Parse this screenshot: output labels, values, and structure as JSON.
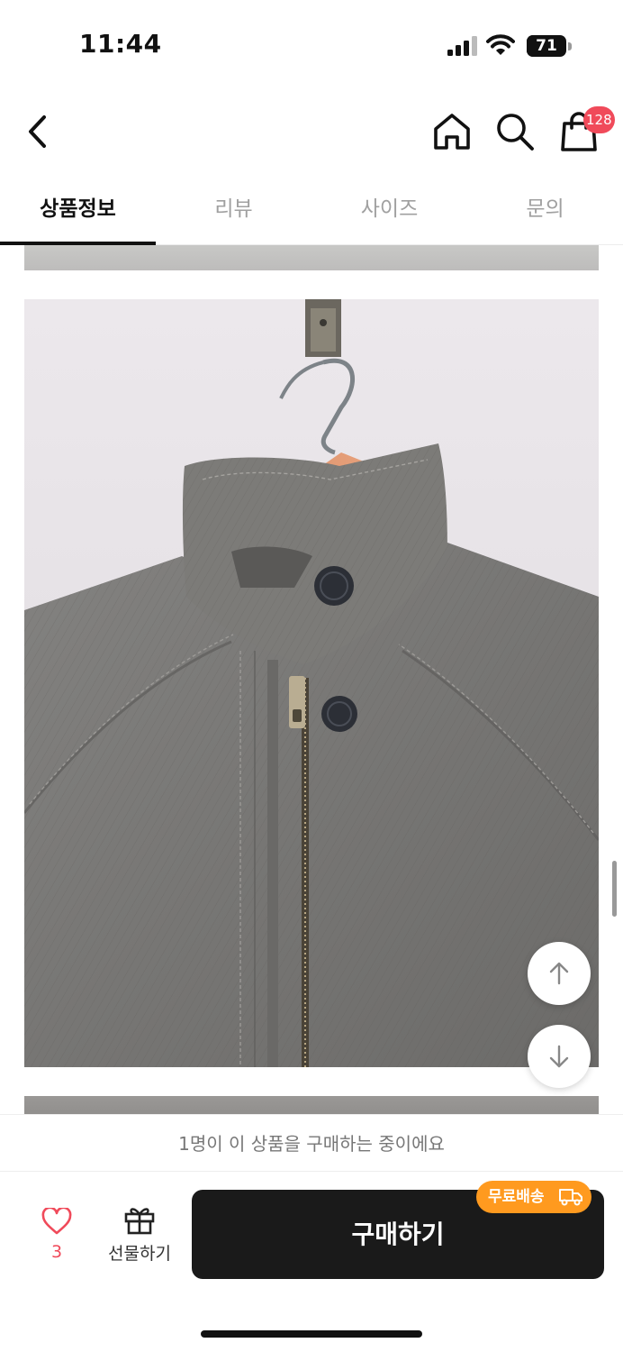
{
  "status_bar": {
    "time": "11:44",
    "battery": "71",
    "battery_level": 0.71
  },
  "header": {
    "back_icon": "chevron-left-icon",
    "home_icon": "home-icon",
    "search_icon": "search-icon",
    "cart_icon": "shopping-bag-icon",
    "cart_badge": "128",
    "badge_color": "#f04a5a"
  },
  "tabs": [
    {
      "label": "상품정보",
      "active": true
    },
    {
      "label": "리뷰",
      "active": false
    },
    {
      "label": "사이즈",
      "active": false
    },
    {
      "label": "문의",
      "active": false
    }
  ],
  "content": {
    "photo_subject": "gray denim zip jacket on wooden hanger",
    "scroll_up_icon": "arrow-up-icon",
    "scroll_down_icon": "arrow-down-icon"
  },
  "notice": {
    "text": "1명이 이 상품을 구매하는 중이에요"
  },
  "bottom_bar": {
    "like_icon": "heart-icon",
    "like_count": "3",
    "gift_icon": "gift-icon",
    "gift_label": "선물하기",
    "buy_label": "구매하기",
    "free_shipping_label": "무료배송",
    "free_shipping_icon": "truck-icon",
    "accent_color": "#ff9a1f",
    "button_color": "#1a1a1a"
  }
}
